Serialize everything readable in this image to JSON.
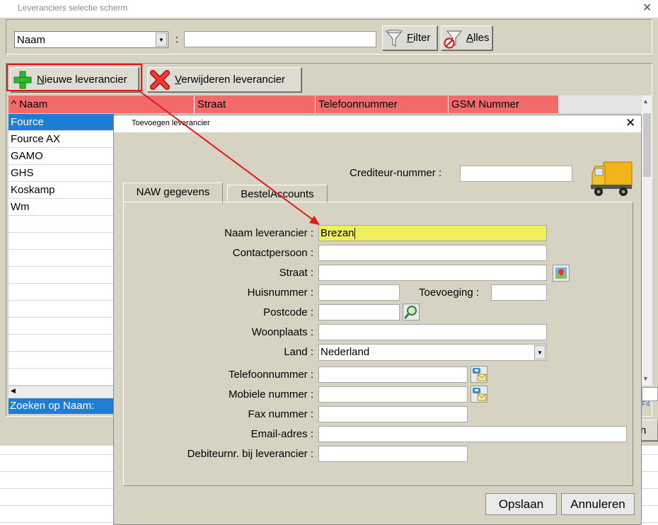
{
  "main": {
    "title": "Leveranciers selectie scherm",
    "filter_field": "Naam",
    "separator": ":",
    "filter_value": "",
    "filter_button": {
      "accel": "F",
      "rest": "ilter"
    },
    "all_button": {
      "accel": "A",
      "rest": "lles"
    },
    "new_button": {
      "accel": "N",
      "rest": "ieuwe leverancier"
    },
    "delete_button": {
      "accel": "V",
      "rest": "erwijderen leverancier"
    },
    "columns": [
      "^ Naam",
      "Straat",
      "Telefoonnummer",
      "GSM Nummer"
    ],
    "rows": [
      "Fource",
      "Fource AX",
      "GAMO",
      "GHS",
      "Koskamp",
      "Wm"
    ],
    "search_label": "Zoeken op Naam:",
    "partial_f4": "F4"
  },
  "dialog": {
    "title": "Toevoegen leverancier",
    "crediteur_label": "Crediteur-nummer :",
    "crediteur_value": "",
    "tabs": [
      "NAW gegevens",
      "BestelAccounts"
    ],
    "fields": {
      "naam": {
        "label": "Naam leverancier :",
        "value": "Brezan"
      },
      "contact": {
        "label": "Contactpersoon :",
        "value": ""
      },
      "straat": {
        "label": "Straat :",
        "value": ""
      },
      "huisnummer": {
        "label": "Huisnummer :",
        "value": ""
      },
      "toevoeging": {
        "label": "Toevoeging :",
        "value": ""
      },
      "postcode": {
        "label": "Postcode :",
        "value": ""
      },
      "woonplaats": {
        "label": "Woonplaats :",
        "value": ""
      },
      "land": {
        "label": "Land :",
        "value": "Nederland"
      },
      "telefoon": {
        "label": "Telefoonnummer :",
        "value": ""
      },
      "mobiel": {
        "label": "Mobiele nummer :",
        "value": ""
      },
      "fax": {
        "label": "Fax nummer :",
        "value": ""
      },
      "email": {
        "label": "Email-adres :",
        "value": ""
      },
      "debiteur": {
        "label": "Debiteurnr. bij leverancier :",
        "value": ""
      }
    },
    "save_button": "Opslaan",
    "cancel_button": "Annuleren"
  },
  "colors": {
    "window_bg": "#d6d3c3",
    "header_red": "#f26a6a",
    "selection_blue": "#1e7ed6",
    "highlight_yellow": "#f0f05a",
    "annotation_red": "#e01818"
  }
}
